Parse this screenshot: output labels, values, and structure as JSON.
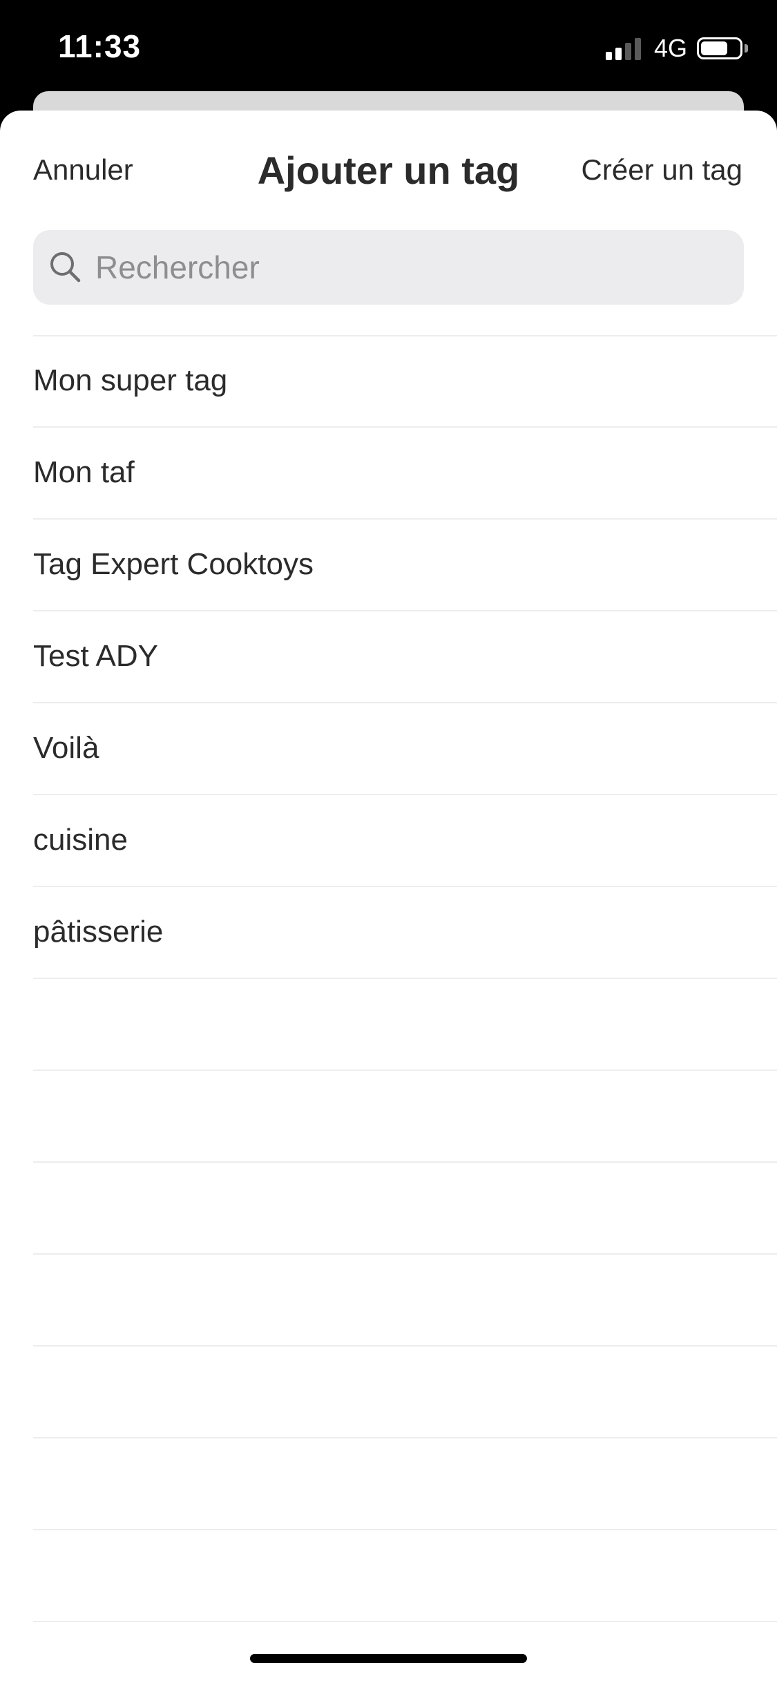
{
  "status_bar": {
    "time": "11:33",
    "network": "4G",
    "signal_bars_active": 2,
    "signal_bars_total": 4,
    "battery_level": 0.7
  },
  "header": {
    "cancel_label": "Annuler",
    "title": "Ajouter un tag",
    "create_label": "Créer un tag"
  },
  "search": {
    "placeholder": "Rechercher",
    "value": ""
  },
  "tags": [
    {
      "label": "Mon super tag"
    },
    {
      "label": "Mon taf"
    },
    {
      "label": "Tag Expert Cooktoys"
    },
    {
      "label": "Test ADY"
    },
    {
      "label": "Voilà"
    },
    {
      "label": "cuisine"
    },
    {
      "label": "pâtisserie"
    }
  ],
  "empty_rows": 7,
  "colors": {
    "text": "#2b2b2b",
    "placeholder": "#8e8e92",
    "search_bg": "#ececee",
    "divider": "#ededed"
  }
}
